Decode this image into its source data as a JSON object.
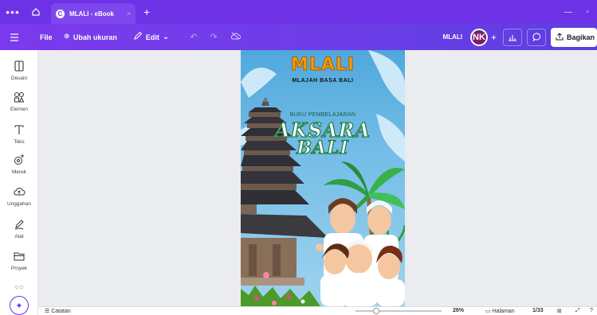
{
  "window": {
    "menu_dots": "•••",
    "tab_title": "MLALI - eBook",
    "tab_close": "×",
    "new_tab": "+",
    "minimize": "—",
    "maximize": "▫"
  },
  "toolbar": {
    "file_label": "File",
    "resize_label": "Ubah ukuran",
    "edit_label": "Edit",
    "project_title": "MLALI",
    "avatar_initials": "NK",
    "add_label": "+",
    "share_label": "Bagikan"
  },
  "sidebar": {
    "items": [
      {
        "label": "Desain",
        "icon": "layout-icon"
      },
      {
        "label": "Elemen",
        "icon": "shapes-icon"
      },
      {
        "label": "Teks",
        "icon": "text-icon"
      },
      {
        "label": "Merek",
        "icon": "brand-icon"
      },
      {
        "label": "Unggahan",
        "icon": "upload-cloud-icon"
      },
      {
        "label": "Alat",
        "icon": "draw-icon"
      },
      {
        "label": "Proyek",
        "icon": "folder-icon"
      }
    ]
  },
  "design": {
    "logo_text": "MLALI",
    "subtitle": "MLAJAH BASA BALI",
    "kicker": "BUKU PEMBELAJARAN",
    "title_line1": "AKSARA",
    "title_line2": "BALI"
  },
  "bottom": {
    "notes_label": "Catatan",
    "zoom": "26%",
    "pages_label": "Halaman",
    "page_count": "1/33"
  },
  "colors": {
    "brand_purple": "#6d32e6",
    "avatar": "#7a1f68",
    "title_green": "#1e7a3c"
  }
}
